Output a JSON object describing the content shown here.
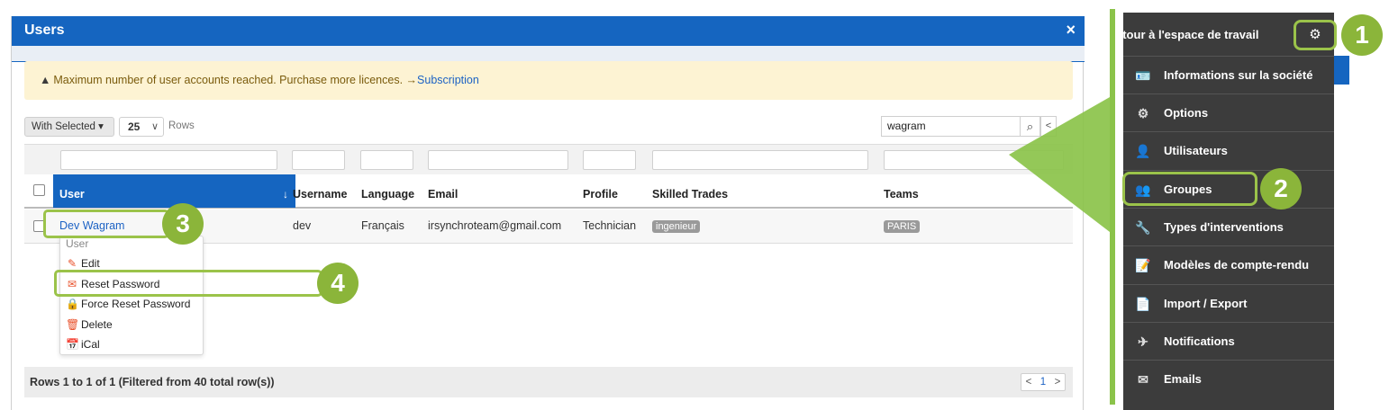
{
  "modal": {
    "title": "Users",
    "close_icon": "×",
    "alert": {
      "text": "Maximum number of user accounts reached. Purchase more licences.",
      "link_arrow": "→",
      "link": "Subscription"
    },
    "toolbar": {
      "with_selected": "With Selected ▾",
      "page_size": "25",
      "rows_label": "Rows"
    },
    "search": {
      "value": "wagram",
      "button": "🔍"
    },
    "table": {
      "columns": [
        "User",
        "Username",
        "Language",
        "Email",
        "Profile",
        "Skilled Trades",
        "Teams"
      ],
      "sort_icon": "↓",
      "rows": [
        {
          "user": "Dev Wagram",
          "username": "dev",
          "language": "Français",
          "email": "irsynchroteam@gmail.com",
          "profile": "Technician",
          "skilled_trades": "ingenieur",
          "teams": "PARIS"
        }
      ]
    },
    "context_menu": {
      "header": "User",
      "items": [
        {
          "label": "Edit",
          "icon": "✎"
        },
        {
          "label": "Reset Password",
          "icon": "✉"
        },
        {
          "label": "Force Reset Password",
          "icon": "🔒"
        },
        {
          "label": "Delete",
          "icon": "🗑"
        },
        {
          "label": "iCal",
          "icon": "📅"
        }
      ]
    },
    "footer": {
      "text": "Rows 1 to 1 of 1 (Filtered from 40 total row(s))",
      "pager_prev": "<",
      "pager_current": "1",
      "pager_next": ">"
    }
  },
  "side_menu": {
    "header": "etour à l'espace de travail",
    "gear_icon": "⚙",
    "items": [
      {
        "label": "Informations sur la société",
        "icon": "🪪"
      },
      {
        "label": "Options",
        "icon": "⚙"
      },
      {
        "label": "Utilisateurs",
        "icon": "👤"
      },
      {
        "label": "Groupes",
        "icon": "👥"
      },
      {
        "label": "Types d'interventions",
        "icon": "🔧"
      },
      {
        "label": "Modèles de compte-rendu",
        "icon": "📝"
      },
      {
        "label": "Import / Export",
        "icon": "📄"
      },
      {
        "label": "Notifications",
        "icon": "✈"
      },
      {
        "label": "Emails",
        "icon": "✉"
      }
    ]
  },
  "callouts": [
    "1",
    "2",
    "3",
    "4"
  ],
  "colors": {
    "primary": "#1565c0",
    "callout": "#8bb53a",
    "menu_bg": "#3c3c3c",
    "alert_bg": "#fdf3d3"
  }
}
